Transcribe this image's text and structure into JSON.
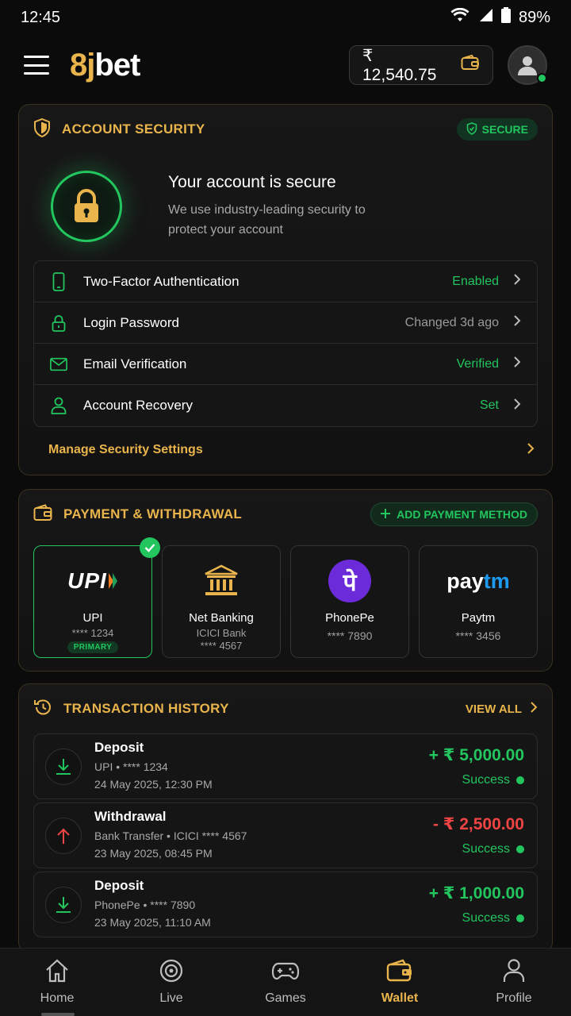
{
  "status": {
    "time": "12:45",
    "battery": "89%"
  },
  "header": {
    "logo_8": "8",
    "logo_j": "j",
    "logo_bet": "bet",
    "balance": "₹ 12,540.75"
  },
  "security": {
    "title": "ACCOUNT SECURITY",
    "badge": "SECURE",
    "hero_title": "Your account is secure",
    "hero_sub": "We use industry-leading security to protect your account",
    "items": [
      {
        "label": "Two-Factor Authentication",
        "value": "Enabled",
        "icon": "phone-icon",
        "tone": "green"
      },
      {
        "label": "Login Password",
        "value": "Changed 3d ago",
        "icon": "lock-icon",
        "tone": "gray"
      },
      {
        "label": "Email Verification",
        "value": "Verified",
        "icon": "mail-icon",
        "tone": "green"
      },
      {
        "label": "Account Recovery",
        "value": "Set",
        "icon": "user-icon",
        "tone": "green"
      }
    ],
    "manage": "Manage Security Settings"
  },
  "payment": {
    "title": "PAYMENT & WITHDRAWAL",
    "add": "ADD PAYMENT METHOD",
    "methods": [
      {
        "logo": "UPI",
        "name": "UPI",
        "line1": "**** 1234",
        "badge": "PRIMARY"
      },
      {
        "name": "Net Banking",
        "line1": "ICICI Bank",
        "line2": "**** 4567"
      },
      {
        "logo": "पे",
        "name": "PhonePe",
        "line1": "**** 7890"
      },
      {
        "logo_a": "pay",
        "logo_b": "tm",
        "name": "Paytm",
        "line1": "**** 3456"
      }
    ]
  },
  "transactions": {
    "title": "TRANSACTION HISTORY",
    "view_all": "VIEW ALL",
    "items": [
      {
        "type": "Deposit",
        "method": "UPI • **** 1234",
        "date": "24 May 2025, 12:30 PM",
        "amount": "+ ₹ 5,000.00",
        "status": "Success"
      },
      {
        "type": "Withdrawal",
        "method": "Bank Transfer • ICICI **** 4567",
        "date": "23 May 2025, 08:45 PM",
        "amount": "- ₹ 2,500.00",
        "status": "Success"
      },
      {
        "type": "Deposit",
        "method": "PhonePe • **** 7890",
        "date": "23 May 2025, 11:10 AM",
        "amount": "+ ₹ 1,000.00",
        "status": "Success"
      }
    ]
  },
  "nav": [
    {
      "label": "Home",
      "icon": "home-icon"
    },
    {
      "label": "Live",
      "icon": "live-icon"
    },
    {
      "label": "Games",
      "icon": "gamepad-icon"
    },
    {
      "label": "Wallet",
      "icon": "wallet-icon",
      "active": true
    },
    {
      "label": "Profile",
      "icon": "profile-icon"
    }
  ],
  "colors": {
    "accent": "#e9b44c",
    "success": "#22c55e",
    "danger": "#ef4444",
    "background": "#0b0b0b"
  }
}
